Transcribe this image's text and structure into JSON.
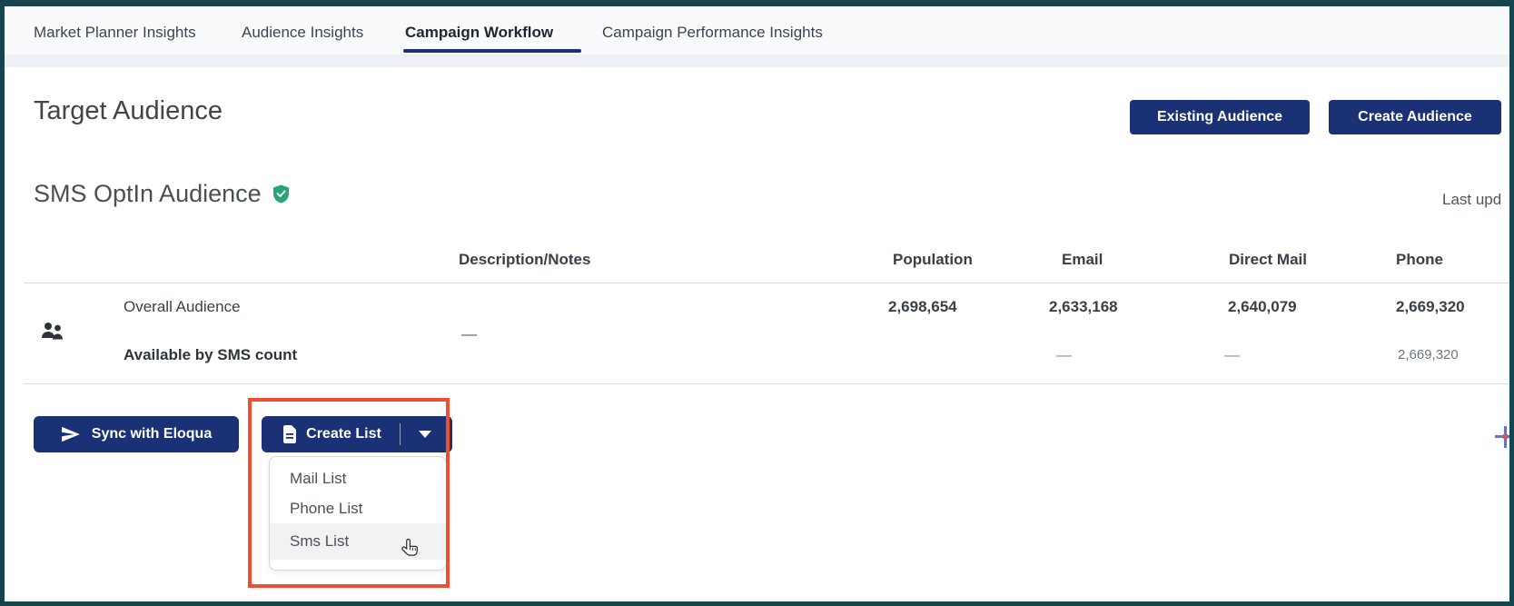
{
  "nav": {
    "tabs": [
      {
        "label": "Market Planner Insights",
        "active": false
      },
      {
        "label": "Audience Insights",
        "active": false
      },
      {
        "label": "Campaign Workflow",
        "active": true
      },
      {
        "label": "Campaign Performance Insights",
        "active": false
      }
    ]
  },
  "page": {
    "title": "Target Audience",
    "last_updated": "Last upd"
  },
  "header_actions": {
    "existing_label": "Existing Audience",
    "create_label": "Create Audience"
  },
  "audience": {
    "name": "SMS OptIn Audience"
  },
  "table": {
    "headers": {
      "description": "Description/Notes",
      "population": "Population",
      "email": "Email",
      "direct_mail": "Direct Mail",
      "phone": "Phone"
    },
    "overall": {
      "label": "Overall Audience",
      "description": "—",
      "population": "2,698,654",
      "email": "2,633,168",
      "direct_mail": "2,640,079",
      "phone": "2,669,320"
    },
    "sms": {
      "label": "Available by SMS count",
      "email": "—",
      "direct_mail": "—",
      "phone": "2,669,320"
    }
  },
  "actions": {
    "sync_label": "Sync with Eloqua",
    "create_list_label": "Create List"
  },
  "dropdown": {
    "items": [
      {
        "label": "Mail List",
        "highlighted": false
      },
      {
        "label": "Phone List",
        "highlighted": false
      },
      {
        "label": "Sms List",
        "highlighted": true
      }
    ]
  },
  "annotations": {
    "plus": "+"
  },
  "colors": {
    "navy": "#1a3176",
    "frame_teal": "#15444f",
    "annotation_orange": "#f04e2f",
    "verified_green": "#2aa377"
  }
}
